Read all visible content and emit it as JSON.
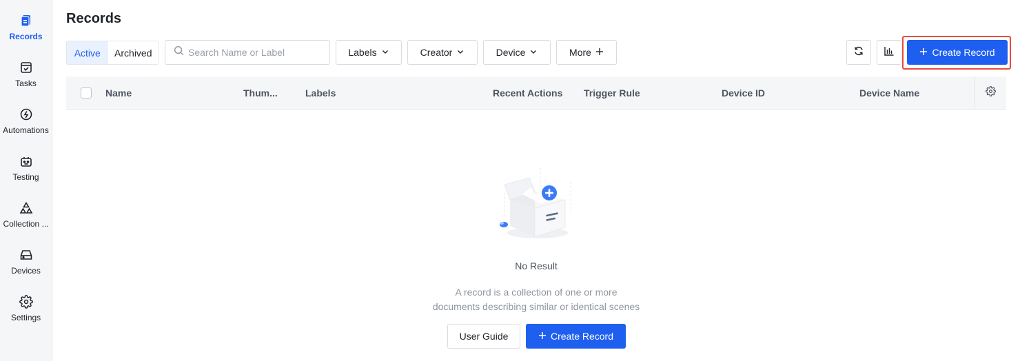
{
  "sidebar": {
    "items": [
      {
        "label": "Records",
        "icon": "records-icon",
        "active": true
      },
      {
        "label": "Tasks",
        "icon": "tasks-icon",
        "active": false
      },
      {
        "label": "Automations",
        "icon": "automations-icon",
        "active": false
      },
      {
        "label": "Testing",
        "icon": "testing-icon",
        "active": false
      },
      {
        "label": "Collection ...",
        "icon": "collection-icon",
        "active": false
      },
      {
        "label": "Devices",
        "icon": "devices-icon",
        "active": false
      },
      {
        "label": "Settings",
        "icon": "settings-icon",
        "active": false
      }
    ]
  },
  "header": {
    "title": "Records"
  },
  "toolbar": {
    "tabs": [
      {
        "label": "Active",
        "selected": true
      },
      {
        "label": "Archived",
        "selected": false
      }
    ],
    "search": {
      "placeholder": "Search Name or Label",
      "value": ""
    },
    "filters": {
      "labels": "Labels",
      "creator": "Creator",
      "device": "Device",
      "more": "More"
    },
    "refresh_icon": "refresh-icon",
    "stats_icon": "bar-chart-icon",
    "create_label": "Create Record"
  },
  "table": {
    "columns": [
      "Name",
      "Thum...",
      "Labels",
      "Recent Actions",
      "Trigger Rule",
      "Device ID",
      "Device Name"
    ],
    "rows": []
  },
  "empty": {
    "title": "No Result",
    "desc_line1": "A record is a collection of one or more",
    "desc_line2": "documents describing similar or identical scenes",
    "guide_label": "User Guide",
    "create_label": "Create Record"
  },
  "colors": {
    "accent": "#1e5ff0",
    "highlight": "#e84a3d",
    "sidebar_bg": "#f5f6f8"
  }
}
